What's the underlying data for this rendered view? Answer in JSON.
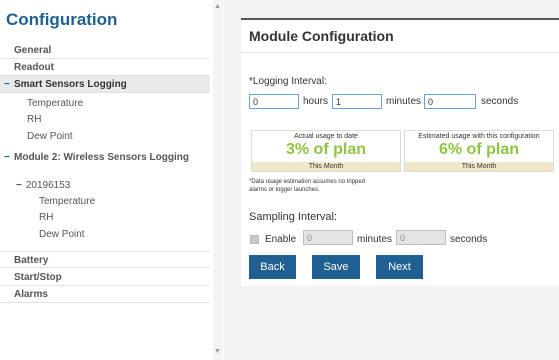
{
  "sidebar": {
    "title": "Configuration",
    "items": [
      {
        "label": "General"
      },
      {
        "label": "Readout"
      },
      {
        "label": "Smart Sensors Logging",
        "expanded_marker": "−"
      },
      {
        "label": "Battery"
      },
      {
        "label": "Start/Stop"
      },
      {
        "label": "Alarms"
      }
    ],
    "smart_sensors_children": [
      "Temperature",
      "RH",
      "Dew Point"
    ],
    "module2": {
      "marker": "−",
      "label": "Module 2: Wireless Sensors Logging",
      "device": {
        "marker": "−",
        "id": "20196153"
      },
      "children": [
        "Temperature",
        "RH",
        "Dew Point"
      ]
    }
  },
  "scrollbar": {
    "up_arrow": "▲",
    "down_arrow": "▼"
  },
  "main": {
    "title": "Module Configuration",
    "logging_interval": {
      "label": "*Logging Interval:",
      "hours_value": "0",
      "hours_label": "hours",
      "minutes_value": "1",
      "minutes_label": "minutes",
      "seconds_value": "0",
      "seconds_label": "seconds"
    },
    "usage_actual": {
      "label": "Actual usage to date",
      "value": "3% of plan",
      "footer": "This Month"
    },
    "usage_estimated": {
      "label": "Estimated usage with this configuration",
      "value": "6% of plan",
      "footer": "This Month"
    },
    "note": "*Data usage estimation assumes no tripped alarms or logger launches.",
    "sampling_interval": {
      "label": "Sampling Interval:",
      "enable_label": "Enable",
      "minutes_value": "0",
      "minutes_label": "minutes",
      "seconds_value": "0",
      "seconds_label": "seconds"
    },
    "buttons": {
      "back": "Back",
      "save": "Save",
      "next": "Next"
    }
  },
  "colors": {
    "accent": "#1f5f91",
    "usage_green": "#8cc63f",
    "usage_footer": "#efe8c8"
  }
}
